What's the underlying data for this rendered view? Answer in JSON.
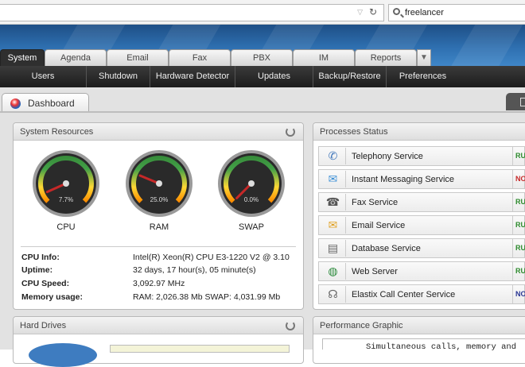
{
  "browser": {
    "search_value": "freelancer"
  },
  "tabs": [
    "System",
    "Agenda",
    "Email",
    "Fax",
    "PBX",
    "IM",
    "Reports"
  ],
  "subnav": [
    "Users",
    "Shutdown",
    "Hardware Detector",
    "Updates",
    "Backup/Restore",
    "Preferences"
  ],
  "dashboard": {
    "title": "Dashboard"
  },
  "system_resources": {
    "title": "System Resources",
    "gauges": [
      {
        "label": "CPU",
        "value_text": "7.7%",
        "value": 7.7
      },
      {
        "label": "RAM",
        "value_text": "25.0%",
        "value": 25.0
      },
      {
        "label": "SWAP",
        "value_text": "0.0%",
        "value": 0.0
      }
    ],
    "info": [
      {
        "key": "CPU Info:",
        "value": "Intel(R) Xeon(R) CPU E3-1220 V2 @ 3.10"
      },
      {
        "key": "Uptime:",
        "value": "32 days, 17 hour(s), 05 minute(s)"
      },
      {
        "key": "CPU Speed:",
        "value": "3,092.97 MHz"
      },
      {
        "key": "Memory usage:",
        "value": "RAM: 2,026.38 Mb SWAP: 4,031.99 Mb"
      }
    ]
  },
  "processes": {
    "title": "Processes Status",
    "items": [
      {
        "name": "Telephony Service",
        "status": "RU",
        "status_color": "#2e8b2e",
        "icon": "phone-icon"
      },
      {
        "name": "Instant Messaging Service",
        "status": "NO",
        "status_color": "#c62828",
        "icon": "chat-icon"
      },
      {
        "name": "Fax Service",
        "status": "RU",
        "status_color": "#2e8b2e",
        "icon": "fax-icon"
      },
      {
        "name": "Email Service",
        "status": "RU",
        "status_color": "#2e8b2e",
        "icon": "mail-icon"
      },
      {
        "name": "Database Service",
        "status": "RU",
        "status_color": "#2e8b2e",
        "icon": "database-icon"
      },
      {
        "name": "Web Server",
        "status": "RU",
        "status_color": "#2e8b2e",
        "icon": "globe-icon"
      },
      {
        "name": "Elastix Call Center Service",
        "status": "NO",
        "status_color": "#283593",
        "icon": "headset-icon"
      }
    ]
  },
  "hard_drives": {
    "title": "Hard Drives"
  },
  "performance": {
    "title": "Performance Graphic",
    "text": "Simultaneous calls, memory and"
  }
}
